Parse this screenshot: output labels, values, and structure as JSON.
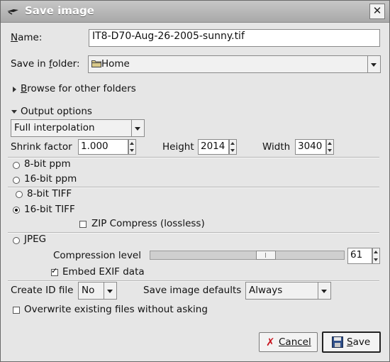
{
  "window": {
    "title": "Save image",
    "close_glyph": "✕"
  },
  "name": {
    "label": "Name:",
    "value": "IT8-D70-Aug-26-2005-sunny.tif"
  },
  "folder": {
    "label": "Save in folder:",
    "value": "Home",
    "icon": "folder-icon"
  },
  "browse": {
    "label": "Browse for other folders"
  },
  "output_options": {
    "label": "Output options",
    "interpolation": "Full interpolation",
    "shrink": {
      "label": "Shrink factor",
      "value": "1.000"
    },
    "height": {
      "label": "Height",
      "value": "2014"
    },
    "width": {
      "label": "Width",
      "value": "3040"
    },
    "formats": [
      {
        "label": "8-bit ppm",
        "selected": false
      },
      {
        "label": "16-bit ppm",
        "selected": false
      },
      {
        "label": "8-bit TIFF",
        "selected": false
      },
      {
        "label": "16-bit TIFF",
        "selected": true
      },
      {
        "label": "JPEG",
        "selected": false
      }
    ],
    "zip": {
      "label": "ZIP Compress (lossless)",
      "checked": false
    },
    "compression": {
      "label": "Compression level",
      "value": "61",
      "fraction": 0.61
    },
    "exif": {
      "label": "Embed EXIF data",
      "checked": true
    }
  },
  "create_id": {
    "label": "Create ID file",
    "value": "No"
  },
  "defaults": {
    "label": "Save image defaults",
    "value": "Always"
  },
  "overwrite": {
    "label": "Overwrite existing files without asking",
    "checked": false
  },
  "buttons": {
    "cancel": "Cancel",
    "save": "Save"
  }
}
